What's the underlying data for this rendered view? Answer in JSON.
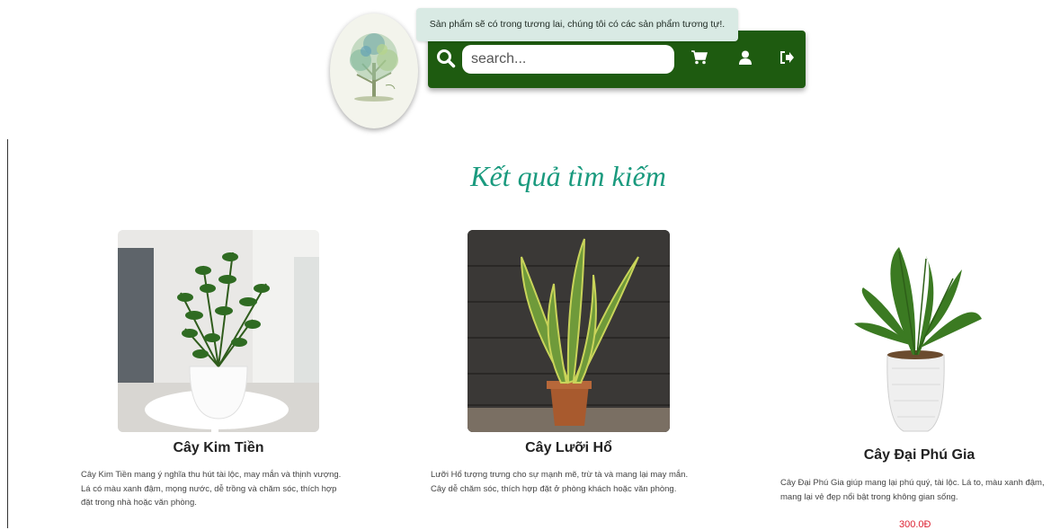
{
  "header": {
    "tooltip": "Sản phẩm sẽ có trong tương lai, chúng tôi có các sản phẩm tương tự!.",
    "search": {
      "placeholder": "search...",
      "value": ""
    }
  },
  "page": {
    "title": "Kết quả tìm kiếm"
  },
  "products": [
    {
      "name": "Cây Kim Tiền",
      "desc": "Cây Kim Tiền mang ý nghĩa thu hút tài lộc, may mắn và thịnh vượng. Lá có màu xanh đậm, mọng nước, dễ trồng và chăm sóc, thích hợp đặt trong nhà hoặc văn phòng."
    },
    {
      "name": "Cây Lưỡi Hổ",
      "desc": "Lưỡi Hổ tượng trưng cho sự mạnh mẽ, trừ tà và mang lại may mắn. Cây dễ chăm sóc, thích hợp đặt ở phòng khách hoặc văn phòng."
    },
    {
      "name": "Cây Đại Phú Gia",
      "desc": "Cây Đại Phú Gia giúp mang lại phú quý, tài lộc. Lá to, màu xanh đậm, mang lại vẻ đẹp nổi bật trong không gian sống.",
      "price": "300.0Đ"
    }
  ],
  "colors": {
    "navbar": "#1e5b10",
    "title": "#1a9a7e",
    "price": "#d22233"
  },
  "icons": [
    "tree-logo",
    "search-icon",
    "cart-icon",
    "user-icon",
    "logout-icon"
  ]
}
